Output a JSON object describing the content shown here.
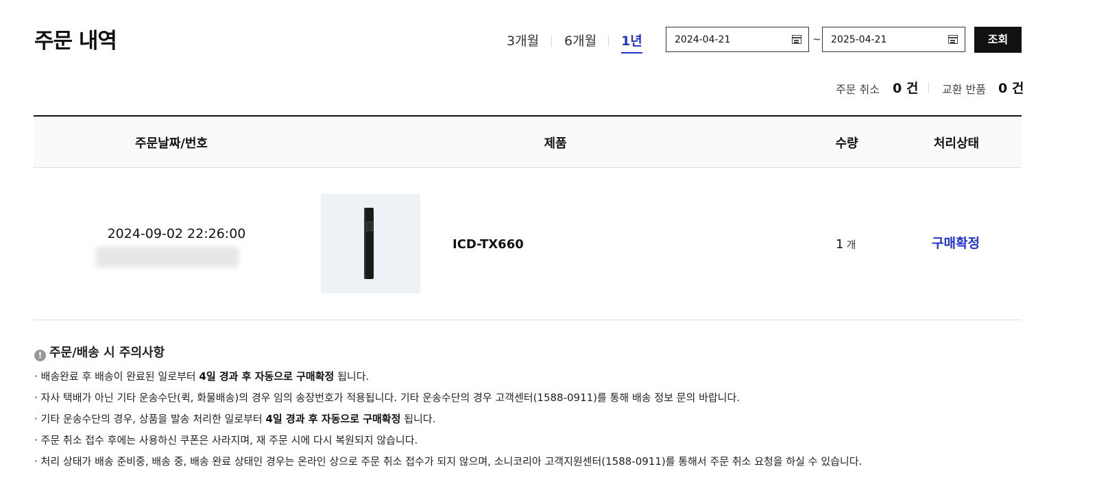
{
  "page_title": "주문 내역",
  "period_tabs": [
    {
      "label": "3개월",
      "active": false
    },
    {
      "label": "6개월",
      "active": false
    },
    {
      "label": "1년",
      "active": true
    }
  ],
  "date_range": {
    "start": "2024-04-21",
    "separator": "~",
    "end": "2025-04-21",
    "icon": "calendar-icon"
  },
  "search_button_label": "조회",
  "counters": {
    "cancel_label": "주문 취소",
    "cancel_value": "0 건",
    "exchange_label": "교환 반품",
    "exchange_value": "0 건"
  },
  "table": {
    "headers": [
      "주문날짜/번호",
      "제품",
      "수량",
      "처리상태"
    ],
    "rows": [
      {
        "order_datetime": "2024-09-02 22:26:00",
        "product_name": "ICD-TX660",
        "quantity": "1",
        "quantity_unit": "개",
        "status": "구매확정"
      }
    ]
  },
  "notice": {
    "title": "주문/배송 시 주의사항",
    "items": [
      {
        "pre": "· 배송완료 후 배송이 완료된 일로부터 ",
        "bold": "4일 경과 후 자동으로 구매확정",
        "post": " 됩니다."
      },
      {
        "pre": "· 자사 택배가 아닌 기타 운송수단(퀵, 화물배송)의 경우 임의 송장번호가 적용됩니다. 기타 운송수단의 경우 고객센터(1588-0911)를 통해 배송 정보 문의 바랍니다.",
        "bold": "",
        "post": ""
      },
      {
        "pre": "· 기타 운송수단의 경우, 상품을 발송 처리한 일로부터 ",
        "bold": "4일 경과 후 자동으로 구매확정",
        "post": " 됩니다."
      },
      {
        "pre": "· 주문 취소 접수 후에는 사용하신 쿠폰은 사라지며, 재 주문 시에 다시 복원되지 않습니다.",
        "bold": "",
        "post": ""
      },
      {
        "pre": "· 처리 상태가 배송 준비중, 배송 중, 배송 완료 상태인 경우는 온라인 상으로 주문 취소 접수가 되지 않으며, 소니코리아 고객지원센터(1588-0911)를 통해서 주문 취소 요청을 하실 수 있습니다.",
        "bold": "",
        "post": ""
      }
    ]
  },
  "colors": {
    "accent": "#2233cc",
    "button_bg": "#111111",
    "header_bg": "#fafafa"
  }
}
